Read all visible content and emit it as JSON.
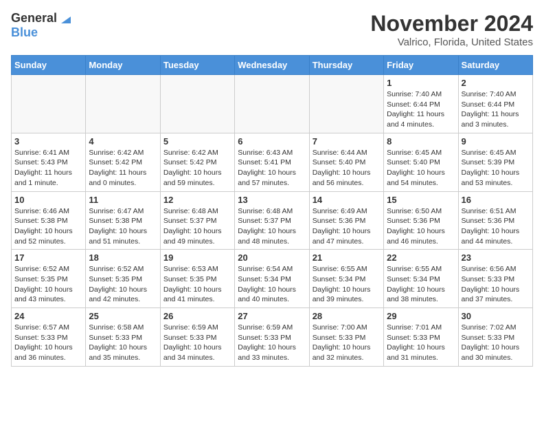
{
  "header": {
    "logo_general": "General",
    "logo_blue": "Blue",
    "month_title": "November 2024",
    "location": "Valrico, Florida, United States"
  },
  "weekdays": [
    "Sunday",
    "Monday",
    "Tuesday",
    "Wednesday",
    "Thursday",
    "Friday",
    "Saturday"
  ],
  "weeks": [
    [
      {
        "day": "",
        "info": ""
      },
      {
        "day": "",
        "info": ""
      },
      {
        "day": "",
        "info": ""
      },
      {
        "day": "",
        "info": ""
      },
      {
        "day": "",
        "info": ""
      },
      {
        "day": "1",
        "info": "Sunrise: 7:40 AM\nSunset: 6:44 PM\nDaylight: 11 hours and 4 minutes."
      },
      {
        "day": "2",
        "info": "Sunrise: 7:40 AM\nSunset: 6:44 PM\nDaylight: 11 hours and 3 minutes."
      }
    ],
    [
      {
        "day": "3",
        "info": "Sunrise: 6:41 AM\nSunset: 5:43 PM\nDaylight: 11 hours and 1 minute."
      },
      {
        "day": "4",
        "info": "Sunrise: 6:42 AM\nSunset: 5:42 PM\nDaylight: 11 hours and 0 minutes."
      },
      {
        "day": "5",
        "info": "Sunrise: 6:42 AM\nSunset: 5:42 PM\nDaylight: 10 hours and 59 minutes."
      },
      {
        "day": "6",
        "info": "Sunrise: 6:43 AM\nSunset: 5:41 PM\nDaylight: 10 hours and 57 minutes."
      },
      {
        "day": "7",
        "info": "Sunrise: 6:44 AM\nSunset: 5:40 PM\nDaylight: 10 hours and 56 minutes."
      },
      {
        "day": "8",
        "info": "Sunrise: 6:45 AM\nSunset: 5:40 PM\nDaylight: 10 hours and 54 minutes."
      },
      {
        "day": "9",
        "info": "Sunrise: 6:45 AM\nSunset: 5:39 PM\nDaylight: 10 hours and 53 minutes."
      }
    ],
    [
      {
        "day": "10",
        "info": "Sunrise: 6:46 AM\nSunset: 5:38 PM\nDaylight: 10 hours and 52 minutes."
      },
      {
        "day": "11",
        "info": "Sunrise: 6:47 AM\nSunset: 5:38 PM\nDaylight: 10 hours and 51 minutes."
      },
      {
        "day": "12",
        "info": "Sunrise: 6:48 AM\nSunset: 5:37 PM\nDaylight: 10 hours and 49 minutes."
      },
      {
        "day": "13",
        "info": "Sunrise: 6:48 AM\nSunset: 5:37 PM\nDaylight: 10 hours and 48 minutes."
      },
      {
        "day": "14",
        "info": "Sunrise: 6:49 AM\nSunset: 5:36 PM\nDaylight: 10 hours and 47 minutes."
      },
      {
        "day": "15",
        "info": "Sunrise: 6:50 AM\nSunset: 5:36 PM\nDaylight: 10 hours and 46 minutes."
      },
      {
        "day": "16",
        "info": "Sunrise: 6:51 AM\nSunset: 5:36 PM\nDaylight: 10 hours and 44 minutes."
      }
    ],
    [
      {
        "day": "17",
        "info": "Sunrise: 6:52 AM\nSunset: 5:35 PM\nDaylight: 10 hours and 43 minutes."
      },
      {
        "day": "18",
        "info": "Sunrise: 6:52 AM\nSunset: 5:35 PM\nDaylight: 10 hours and 42 minutes."
      },
      {
        "day": "19",
        "info": "Sunrise: 6:53 AM\nSunset: 5:35 PM\nDaylight: 10 hours and 41 minutes."
      },
      {
        "day": "20",
        "info": "Sunrise: 6:54 AM\nSunset: 5:34 PM\nDaylight: 10 hours and 40 minutes."
      },
      {
        "day": "21",
        "info": "Sunrise: 6:55 AM\nSunset: 5:34 PM\nDaylight: 10 hours and 39 minutes."
      },
      {
        "day": "22",
        "info": "Sunrise: 6:55 AM\nSunset: 5:34 PM\nDaylight: 10 hours and 38 minutes."
      },
      {
        "day": "23",
        "info": "Sunrise: 6:56 AM\nSunset: 5:33 PM\nDaylight: 10 hours and 37 minutes."
      }
    ],
    [
      {
        "day": "24",
        "info": "Sunrise: 6:57 AM\nSunset: 5:33 PM\nDaylight: 10 hours and 36 minutes."
      },
      {
        "day": "25",
        "info": "Sunrise: 6:58 AM\nSunset: 5:33 PM\nDaylight: 10 hours and 35 minutes."
      },
      {
        "day": "26",
        "info": "Sunrise: 6:59 AM\nSunset: 5:33 PM\nDaylight: 10 hours and 34 minutes."
      },
      {
        "day": "27",
        "info": "Sunrise: 6:59 AM\nSunset: 5:33 PM\nDaylight: 10 hours and 33 minutes."
      },
      {
        "day": "28",
        "info": "Sunrise: 7:00 AM\nSunset: 5:33 PM\nDaylight: 10 hours and 32 minutes."
      },
      {
        "day": "29",
        "info": "Sunrise: 7:01 AM\nSunset: 5:33 PM\nDaylight: 10 hours and 31 minutes."
      },
      {
        "day": "30",
        "info": "Sunrise: 7:02 AM\nSunset: 5:33 PM\nDaylight: 10 hours and 30 minutes."
      }
    ]
  ]
}
